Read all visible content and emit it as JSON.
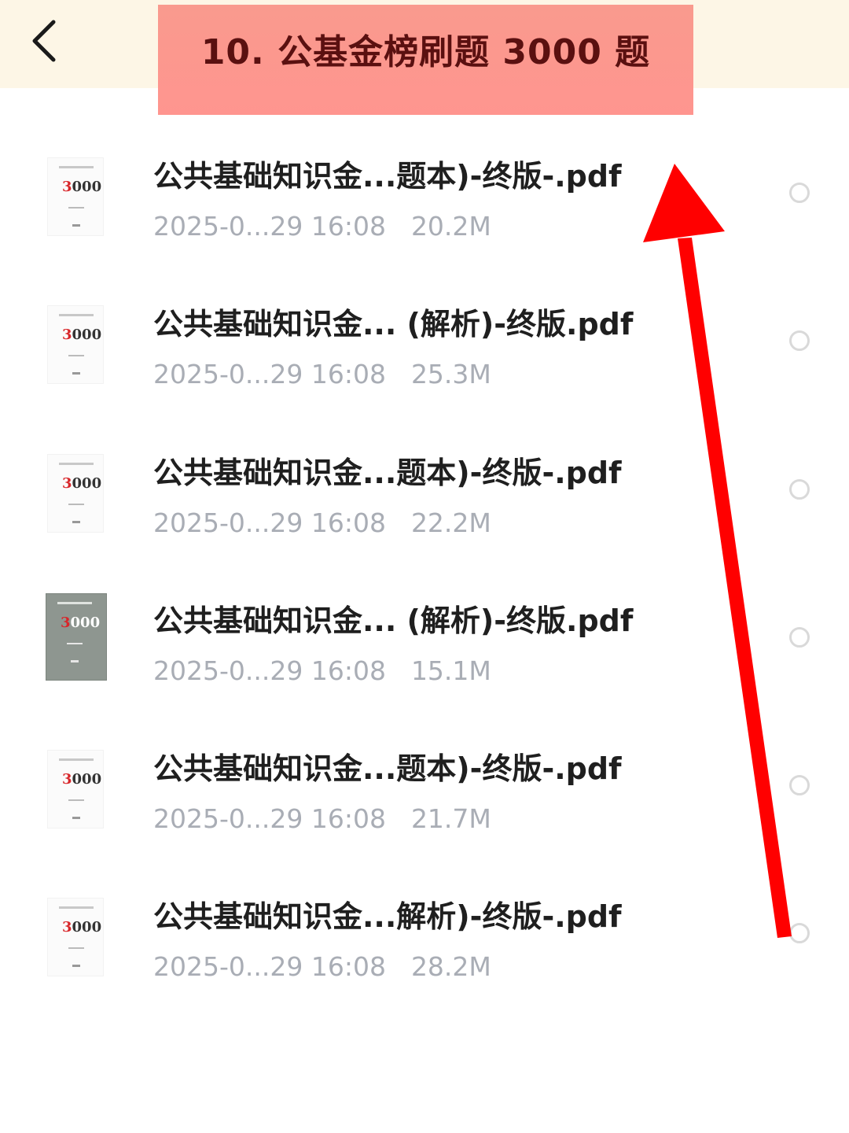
{
  "header": {
    "back_icon": "chevron-left-icon",
    "title": "10. 公基金榜刷题 3000 题"
  },
  "files": [
    {
      "name": "公共基础知识金...题本)-终版-.pdf",
      "date": "2025-0...29 16:08",
      "size": "20.2M",
      "thumb_title": "公共基础知识",
      "thumb_number": "3000"
    },
    {
      "name": "公共基础知识金... (解析)-终版.pdf",
      "date": "2025-0...29 16:08",
      "size": "25.3M",
      "thumb_title": "公共基础知识",
      "thumb_number": "3000"
    },
    {
      "name": "公共基础知识金...题本)-终版-.pdf",
      "date": "2025-0...29 16:08",
      "size": "22.2M",
      "thumb_title": "公共基础知识",
      "thumb_number": "3000"
    },
    {
      "name": "公共基础知识金... (解析)-终版.pdf",
      "date": "2025-0...29 16:08",
      "size": "15.1M",
      "thumb_title": "公共基础知识",
      "thumb_number": "3000"
    },
    {
      "name": "公共基础知识金...题本)-终版-.pdf",
      "date": "2025-0...29 16:08",
      "size": "21.7M",
      "thumb_title": "公共基础知识",
      "thumb_number": "3000"
    },
    {
      "name": "公共基础知识金...解析)-终版-.pdf",
      "date": "2025-0...29 16:08",
      "size": "28.2M",
      "thumb_title": "公共基础知识",
      "thumb_number": "3000"
    }
  ],
  "colors": {
    "header_background": "#fdf6e6",
    "title_banner": "#ff958f",
    "annotation_arrow": "#ff0000",
    "meta_text": "#a9adb5"
  },
  "annotation": {
    "type": "arrow",
    "direction": "up",
    "icon": "red-arrow-icon"
  }
}
